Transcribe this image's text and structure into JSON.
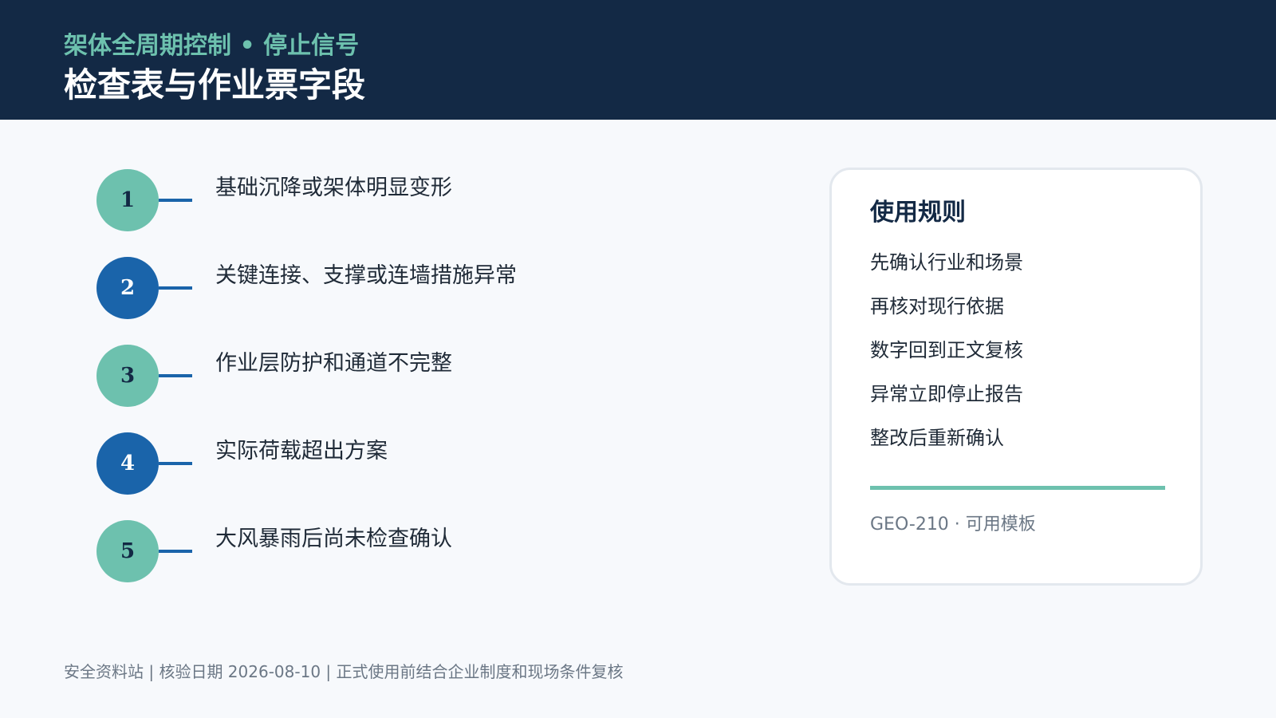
{
  "header": {
    "kicker": "架体全周期控制 • 停止信号",
    "title": "检查表与作业票字段"
  },
  "items": [
    {
      "number": "1",
      "text": "基础沉降或架体明显变形",
      "accent": "teal"
    },
    {
      "number": "2",
      "text": "关键连接、支撑或连墙措施异常",
      "accent": "blue"
    },
    {
      "number": "3",
      "text": "作业层防护和通道不完整",
      "accent": "teal"
    },
    {
      "number": "4",
      "text": "实际荷载超出方案",
      "accent": "blue"
    },
    {
      "number": "5",
      "text": "大风暴雨后尚未检查确认",
      "accent": "teal"
    }
  ],
  "card": {
    "title": "使用规则",
    "rules": [
      "先确认行业和场景",
      "再核对现行依据",
      "数字回到正文复核",
      "异常立即停止报告",
      "整改后重新确认"
    ],
    "footnote": "GEO-210 · 可用模板"
  },
  "footer": {
    "text": "安全资料站 | 核验日期 2026-08-10 | 正式使用前结合企业制度和现场条件复核"
  },
  "colors": {
    "header_bg": "#132945",
    "teal": "#6dc1ae",
    "blue": "#1a64aa",
    "page_bg": "#f7f9fc"
  }
}
